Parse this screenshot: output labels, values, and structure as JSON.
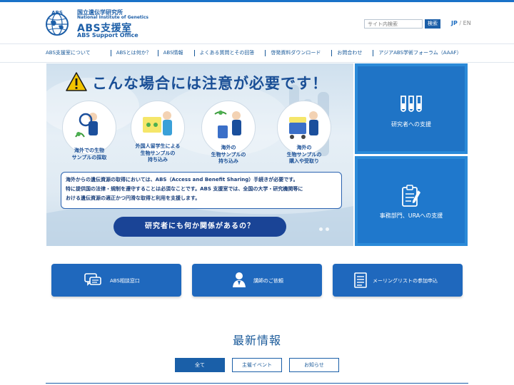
{
  "header": {
    "org_jp": "国立遺伝学研究所",
    "org_en": "National Institute of Genetics",
    "title": "ABS支援室",
    "subtitle": "ABS Support Office",
    "logo_text": "ABS"
  },
  "search": {
    "placeholder": "サイト内検索",
    "button_label": "検索"
  },
  "language": {
    "jp": "JP",
    "separator": "/",
    "en": "EN"
  },
  "nav": {
    "items": [
      {
        "label": "ABS支援室について"
      },
      {
        "label": "ABSとは何か？"
      },
      {
        "label": "ABS情報"
      },
      {
        "label": "よくある質問とその回答"
      },
      {
        "label": "啓発資料ダウンロード"
      },
      {
        "label": "お問合わせ"
      },
      {
        "label": "アジアABS学術フォーラム（AAAF）"
      }
    ]
  },
  "hero": {
    "warning_title": "こんな場合には注意が必要です！",
    "cases": [
      {
        "line1": "海外での生物",
        "line2": "サンプルの採取",
        "line3": ""
      },
      {
        "line1": "外国人留学生による",
        "line2": "生物サンプルの",
        "line3": "持ち込み"
      },
      {
        "line1": "海外の",
        "line2": "生物サンプルの",
        "line3": "持ち込み"
      },
      {
        "line1": "海外の",
        "line2": "生物サンプルの",
        "line3": "購入や受取り"
      }
    ],
    "info_lines": [
      "海外からの遺伝資源の取得においては、ABS（Access and Benefit Sharing）手続きが必要です。",
      "特に提供国の法律・規制を遵守することは必須なことです。ABS 支援室では、全国の大学・研究機関等に",
      "おける遺伝資源の適正かつ円滑な取得と利用を支援します。"
    ],
    "cta_label": "研究者にも何か関係があるの？"
  },
  "side_panels": [
    {
      "label": "研究者への支援",
      "icon": "test-tubes-icon"
    },
    {
      "label": "事務部門、URAへの支援",
      "icon": "clipboard-icon"
    }
  ],
  "cards": [
    {
      "label": "ABS相談窓口",
      "icon": "chat-bubbles-icon"
    },
    {
      "label": "講師のご依頼",
      "icon": "lecturer-icon"
    },
    {
      "label": "メーリングリストの参加申込",
      "icon": "list-icon"
    }
  ],
  "news": {
    "title": "最新情報",
    "tabs": [
      {
        "label": "全て",
        "active": true
      },
      {
        "label": "主催イベント",
        "active": false
      },
      {
        "label": "お知らせ",
        "active": false
      }
    ]
  },
  "colors": {
    "brand": "#1a5fa8",
    "accent": "#1f74c6",
    "warning": "#f2c400",
    "hero_button": "#1a4496"
  }
}
